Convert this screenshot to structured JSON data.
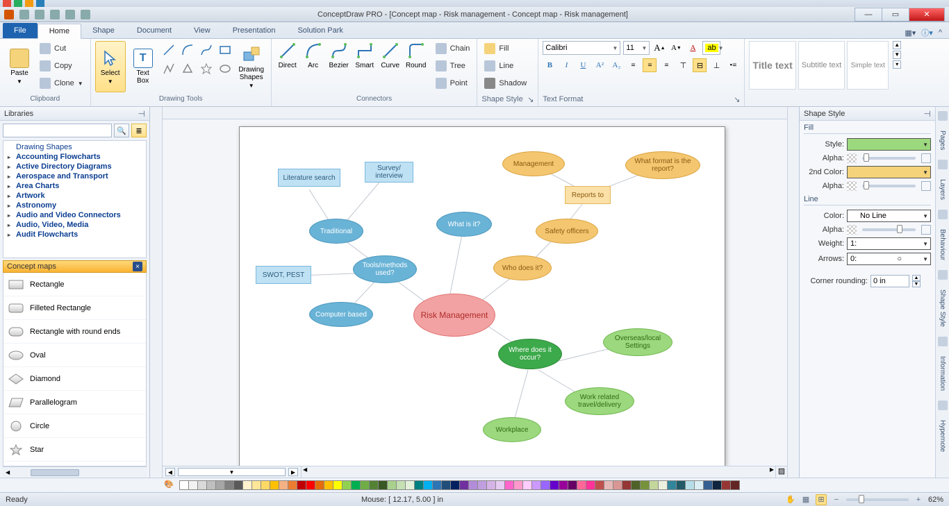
{
  "app": {
    "title": "ConceptDraw PRO - [Concept map - Risk management - Concept map - Risk management]"
  },
  "tabs": {
    "file": "File",
    "home": "Home",
    "shape": "Shape",
    "document": "Document",
    "view": "View",
    "presentation": "Presentation",
    "solution": "Solution Park"
  },
  "ribbon": {
    "clipboard": {
      "label": "Clipboard",
      "paste": "Paste",
      "cut": "Cut",
      "copy": "Copy",
      "clone": "Clone"
    },
    "drawing": {
      "label": "Drawing Tools",
      "select": "Select",
      "textbox": "Text\nBox",
      "shapes": "Drawing\nShapes"
    },
    "connectors": {
      "label": "Connectors",
      "direct": "Direct",
      "arc": "Arc",
      "bezier": "Bezier",
      "smart": "Smart",
      "curve": "Curve",
      "round": "Round",
      "chain": "Chain",
      "tree": "Tree",
      "point": "Point"
    },
    "shapestyle": {
      "label": "Shape Style",
      "fill": "Fill",
      "line": "Line",
      "shadow": "Shadow"
    },
    "textformat": {
      "label": "Text Format",
      "font": "Calibri",
      "size": "11"
    },
    "headings": {
      "title": "Title text",
      "subtitle": "Subtitle text",
      "simple": "Simple text"
    }
  },
  "left": {
    "header": "Libraries",
    "tree": [
      "Drawing Shapes",
      "Accounting Flowcharts",
      "Active Directory Diagrams",
      "Aerospace and Transport",
      "Area Charts",
      "Artwork",
      "Astronomy",
      "Audio and Video Connectors",
      "Audio, Video, Media",
      "Audit Flowcharts"
    ],
    "section": "Concept maps",
    "shapes": [
      "Rectangle",
      "Filleted Rectangle",
      "Rectangle with round ends",
      "Oval",
      "Diamond",
      "Parallelogram",
      "Circle",
      "Star"
    ]
  },
  "right": {
    "header": "Shape Style",
    "fill": "Fill",
    "style": "Style:",
    "alpha": "Alpha:",
    "second": "2nd Color:",
    "line": "Line",
    "color": "Color:",
    "noline": "No Line",
    "weight": "Weight:",
    "wval": "1:",
    "arrows": "Arrows:",
    "aval": "0:",
    "corner": "Corner rounding:",
    "cval": "0 in",
    "tabs": {
      "pages": "Pages",
      "layers": "Layers",
      "behaviour": "Behaviour",
      "shapestyle": "Shape Style",
      "information": "Information",
      "hypernote": "Hypernote"
    }
  },
  "canvas": {
    "nodes": {
      "lit": "Literature search",
      "survey": "Survey/\ninterview",
      "mgmt": "Management",
      "format": "What format is the report?",
      "reports": "Reports to",
      "trad": "Traditional",
      "whatis": "What is it?",
      "safety": "Safety officers",
      "swot": "SWOT, PEST",
      "tools": "Tools/methods used?",
      "who": "Who does it?",
      "comp": "Computer based",
      "risk": "Risk Management",
      "where": "Where does it occur?",
      "overseas": "Overseas/local Settings",
      "travel": "Work related travel/delivery",
      "workplace": "Workplace"
    }
  },
  "status": {
    "ready": "Ready",
    "mouse": "Mouse: [ 12.17, 5.00 ] in",
    "zoom": "62%"
  },
  "colors": [
    "#ffffff",
    "#f2f2f2",
    "#d9d9d9",
    "#bfbfbf",
    "#a6a6a6",
    "#808080",
    "#595959",
    "#fff2cc",
    "#ffe699",
    "#ffd966",
    "#ffc000",
    "#f4b183",
    "#ed7d31",
    "#c00000",
    "#ff0000",
    "#e46c0a",
    "#ffc000",
    "#ffff00",
    "#92d050",
    "#00b050",
    "#70ad47",
    "#548235",
    "#385723",
    "#a9d18e",
    "#c5e0b4",
    "#e2f0d9",
    "#008080",
    "#00b0f0",
    "#2e75b6",
    "#1f4e79",
    "#002060",
    "#7030a0",
    "#b38cd9",
    "#c19ee0",
    "#d6b3e6",
    "#e6ccf2",
    "#ff66cc",
    "#ff99cc",
    "#ffccff",
    "#cc99ff",
    "#9966ff",
    "#6600cc",
    "#990099",
    "#660066",
    "#ff6699",
    "#ff3399",
    "#c0504d",
    "#e6b8b7",
    "#d99694",
    "#953735",
    "#4f6228",
    "#76933c",
    "#c4d79b",
    "#ebf1de",
    "#31869b",
    "#215967",
    "#b7dee8",
    "#daeef3",
    "#366092",
    "#0f243e",
    "#963634",
    "#632523"
  ]
}
